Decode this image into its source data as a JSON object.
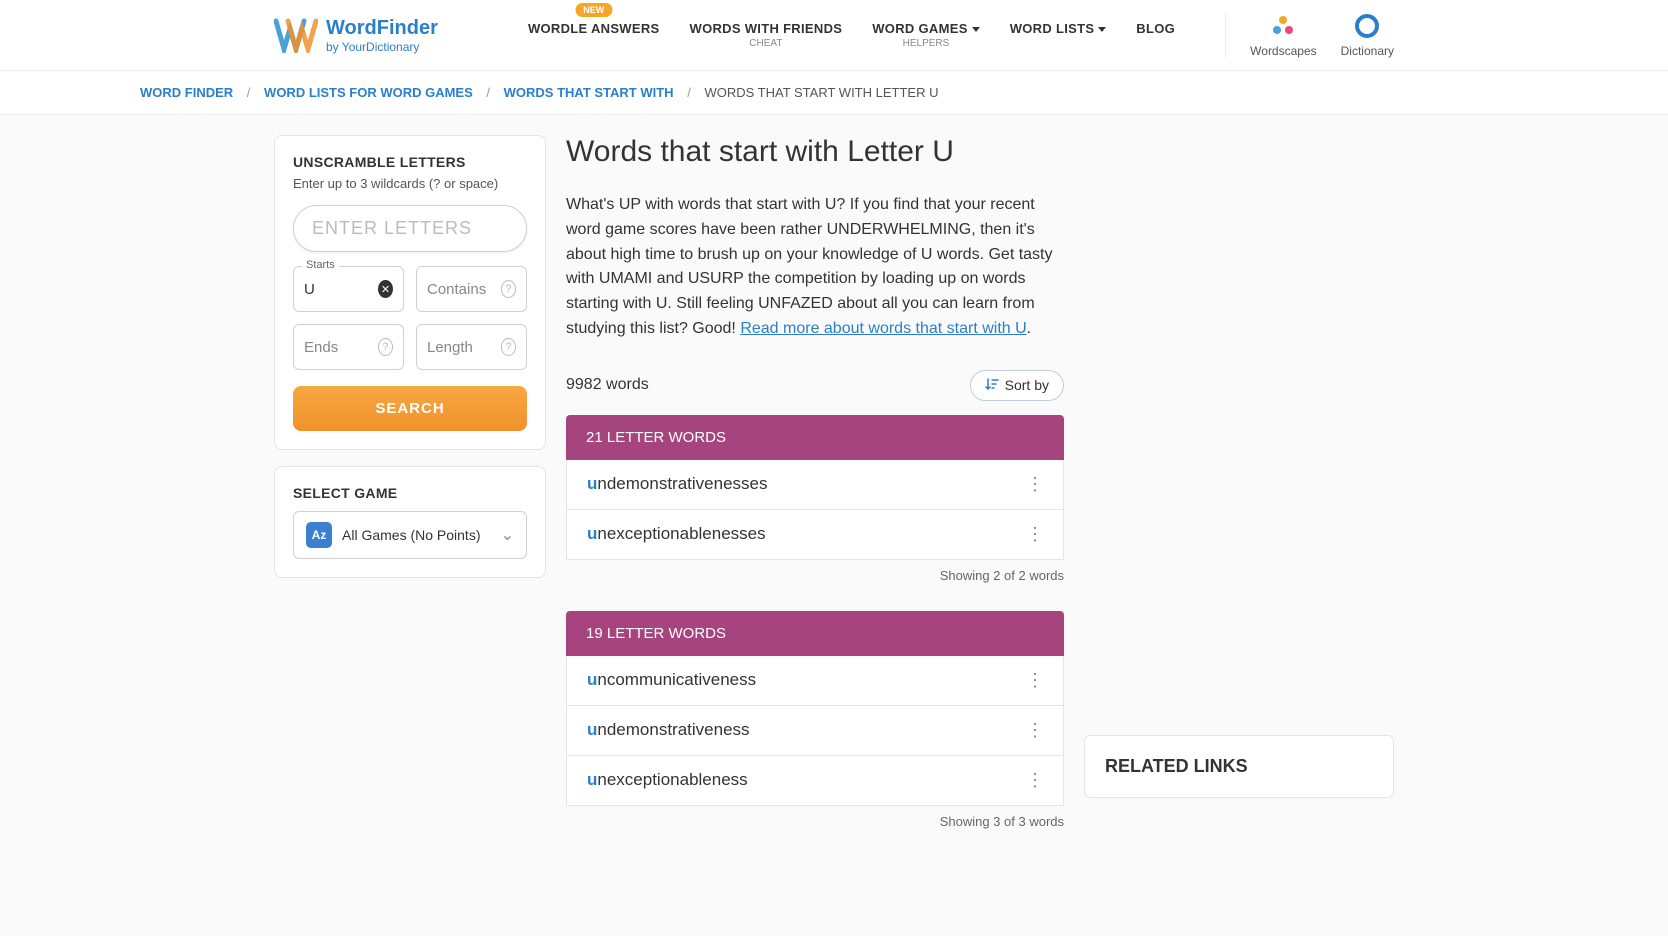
{
  "header": {
    "logo": {
      "main": "WordFinder",
      "sub": "by YourDictionary"
    },
    "nav": [
      {
        "label": "WORDLE ANSWERS",
        "badge": "NEW"
      },
      {
        "label": "WORDS WITH FRIENDS",
        "sub": "CHEAT"
      },
      {
        "label": "WORD GAMES",
        "sub": "HELPERS",
        "dropdown": true
      },
      {
        "label": "WORD LISTS",
        "dropdown": true
      },
      {
        "label": "BLOG"
      }
    ],
    "right": [
      {
        "label": "Wordscapes"
      },
      {
        "label": "Dictionary"
      }
    ]
  },
  "breadcrumb": {
    "items": [
      "WORD FINDER",
      "WORD LISTS FOR WORD GAMES",
      "WORDS THAT START WITH"
    ],
    "current": "WORDS THAT START WITH LETTER U"
  },
  "sidebar": {
    "unscramble": {
      "title": "UNSCRAMBLE LETTERS",
      "hint": "Enter up to 3 wildcards (? or space)",
      "placeholder": "ENTER LETTERS",
      "starts_label": "Starts",
      "starts_value": "U",
      "contains_label": "Contains",
      "ends_label": "Ends",
      "length_label": "Length",
      "search": "SEARCH"
    },
    "select_game": {
      "title": "SELECT GAME",
      "icon_text": "Az",
      "value": "All Games (No Points)"
    }
  },
  "page": {
    "title": "Words that start with Letter U",
    "intro": "What's UP with words that start with U? If you find that your recent word game scores have been rather UNDERWHELMING, then it's about high time to brush up on your knowledge of U words. Get tasty with UMAMI and USURP the competition by loading up on words starting with U. Still feeling UNFAZED about all you can learn from studying this list? Good! ",
    "intro_link": "Read more about words that start with U",
    "intro_after": ".",
    "count": "9982 words",
    "sort": "Sort by",
    "groups": [
      {
        "header": "21 LETTER WORDS",
        "words": [
          {
            "prefix": "u",
            "rest": "ndemonstrativenesses"
          },
          {
            "prefix": "u",
            "rest": "nexceptionablenesses"
          }
        ],
        "showing": "Showing 2 of 2 words"
      },
      {
        "header": "19 LETTER WORDS",
        "words": [
          {
            "prefix": "u",
            "rest": "ncommunicativeness"
          },
          {
            "prefix": "u",
            "rest": "ndemonstrativeness"
          },
          {
            "prefix": "u",
            "rest": "nexceptionableness"
          }
        ],
        "showing": "Showing 3 of 3 words"
      }
    ]
  },
  "related": {
    "title": "RELATED LINKS"
  }
}
